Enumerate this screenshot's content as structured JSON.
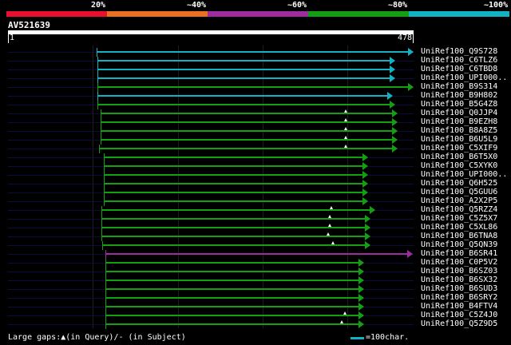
{
  "scale": {
    "labels": [
      "20%",
      "~40%",
      "~60%",
      "~80%",
      "~100%"
    ],
    "colors": [
      "#e8102e",
      "#e87020",
      "#9e2c9e",
      "#12a012",
      "#12b2c2"
    ]
  },
  "query": {
    "id": "AV521639",
    "start": "1",
    "end": "478",
    "length": 478
  },
  "grid_positions": [
    100,
    200,
    300,
    400
  ],
  "hits": [
    {
      "name": "UniRef100_Q9S728",
      "start": 104,
      "end": 478,
      "tier": 4,
      "arrow": "end",
      "gaps": []
    },
    {
      "name": "UniRef100_C6TLZ6",
      "start": 105,
      "end": 456,
      "tier": 4,
      "arrow": "end",
      "gaps": []
    },
    {
      "name": "UniRef100_C6TBD8",
      "start": 105,
      "end": 456,
      "tier": 4,
      "arrow": "end",
      "gaps": []
    },
    {
      "name": "UniRef100_UPI000..",
      "start": 105,
      "end": 456,
      "tier": 4,
      "arrow": "end",
      "gaps": []
    },
    {
      "name": "UniRef100_B9S314",
      "start": 105,
      "end": 478,
      "tier": 3,
      "arrow": "end",
      "gaps": []
    },
    {
      "name": "UniRef100_B9H802",
      "start": 105,
      "end": 454,
      "tier": 4,
      "arrow": "end",
      "gaps": []
    },
    {
      "name": "UniRef100_B5G4Z8",
      "start": 105,
      "end": 456,
      "tier": 3,
      "arrow": "end",
      "gaps": []
    },
    {
      "name": "UniRef100_Q0JJP4",
      "start": 109,
      "end": 459,
      "tier": 3,
      "arrow": "end",
      "gaps": [
        397
      ]
    },
    {
      "name": "UniRef100_B9EZH8",
      "start": 109,
      "end": 459,
      "tier": 3,
      "arrow": "end",
      "gaps": [
        397
      ]
    },
    {
      "name": "UniRef100_B8A8Z5",
      "start": 109,
      "end": 459,
      "tier": 3,
      "arrow": "end",
      "gaps": [
        397
      ]
    },
    {
      "name": "UniRef100_B6U5L9",
      "start": 109,
      "end": 459,
      "tier": 3,
      "arrow": "end",
      "gaps": [
        397
      ]
    },
    {
      "name": "UniRef100_C5XIF9",
      "start": 107,
      "end": 459,
      "tier": 3,
      "arrow": "end",
      "gaps": [
        397
      ]
    },
    {
      "name": "UniRef100_B6T5X0",
      "start": 113,
      "end": 424,
      "tier": 3,
      "arrow": "end",
      "gaps": []
    },
    {
      "name": "UniRef100_C5XYK0",
      "start": 113,
      "end": 424,
      "tier": 3,
      "arrow": "end",
      "gaps": []
    },
    {
      "name": "UniRef100_UPI000..",
      "start": 113,
      "end": 424,
      "tier": 3,
      "arrow": "end",
      "gaps": []
    },
    {
      "name": "UniRef100_Q6H525",
      "start": 113,
      "end": 424,
      "tier": 3,
      "arrow": "end",
      "gaps": []
    },
    {
      "name": "UniRef100_Q5GUU6",
      "start": 113,
      "end": 424,
      "tier": 3,
      "arrow": "end",
      "gaps": []
    },
    {
      "name": "UniRef100_A2X2P5",
      "start": 113,
      "end": 424,
      "tier": 3,
      "arrow": "end",
      "gaps": []
    },
    {
      "name": "UniRef100_Q5RZZ4",
      "start": 110,
      "end": 433,
      "tier": 3,
      "arrow": "end",
      "gaps": [
        380
      ]
    },
    {
      "name": "UniRef100_C5Z5X7",
      "start": 110,
      "end": 427,
      "tier": 3,
      "arrow": "end",
      "gaps": [
        378
      ]
    },
    {
      "name": "UniRef100_C5XL86",
      "start": 110,
      "end": 427,
      "tier": 3,
      "arrow": "end",
      "gaps": [
        378
      ]
    },
    {
      "name": "UniRef100_B6TNA8",
      "start": 110,
      "end": 427,
      "tier": 3,
      "arrow": "end",
      "gaps": [
        376
      ]
    },
    {
      "name": "UniRef100_Q5QN39",
      "start": 111,
      "end": 427,
      "tier": 3,
      "arrow": "end",
      "gaps": [
        382
      ]
    },
    {
      "name": "UniRef100_B6SR41",
      "start": 115,
      "end": 477,
      "tier": 2,
      "arrow": "end",
      "gaps": []
    },
    {
      "name": "UniRef100_C0P5V2",
      "start": 115,
      "end": 420,
      "tier": 3,
      "arrow": "end",
      "gaps": []
    },
    {
      "name": "UniRef100_B6SZ03",
      "start": 115,
      "end": 420,
      "tier": 3,
      "arrow": "end",
      "gaps": []
    },
    {
      "name": "UniRef100_B6SX32",
      "start": 115,
      "end": 420,
      "tier": 3,
      "arrow": "end",
      "gaps": []
    },
    {
      "name": "UniRef100_B6SUD3",
      "start": 115,
      "end": 420,
      "tier": 3,
      "arrow": "end",
      "gaps": []
    },
    {
      "name": "UniRef100_B6SRY2",
      "start": 115,
      "end": 420,
      "tier": 3,
      "arrow": "end",
      "gaps": []
    },
    {
      "name": "UniRef100_B4FTV4",
      "start": 115,
      "end": 420,
      "tier": 3,
      "arrow": "end",
      "gaps": []
    },
    {
      "name": "UniRef100_C5Z4J0",
      "start": 115,
      "end": 420,
      "tier": 3,
      "arrow": "end",
      "gaps": [
        396
      ]
    },
    {
      "name": "UniRef100_Q5Z9D5",
      "start": 115,
      "end": 420,
      "tier": 3,
      "arrow": "end",
      "gaps": [
        392
      ]
    }
  ],
  "legend": {
    "text": "Large gaps:▲(in Query)/- (in Subject)",
    "scale_text": "=100char.",
    "scale_color": "#12b2c2"
  }
}
